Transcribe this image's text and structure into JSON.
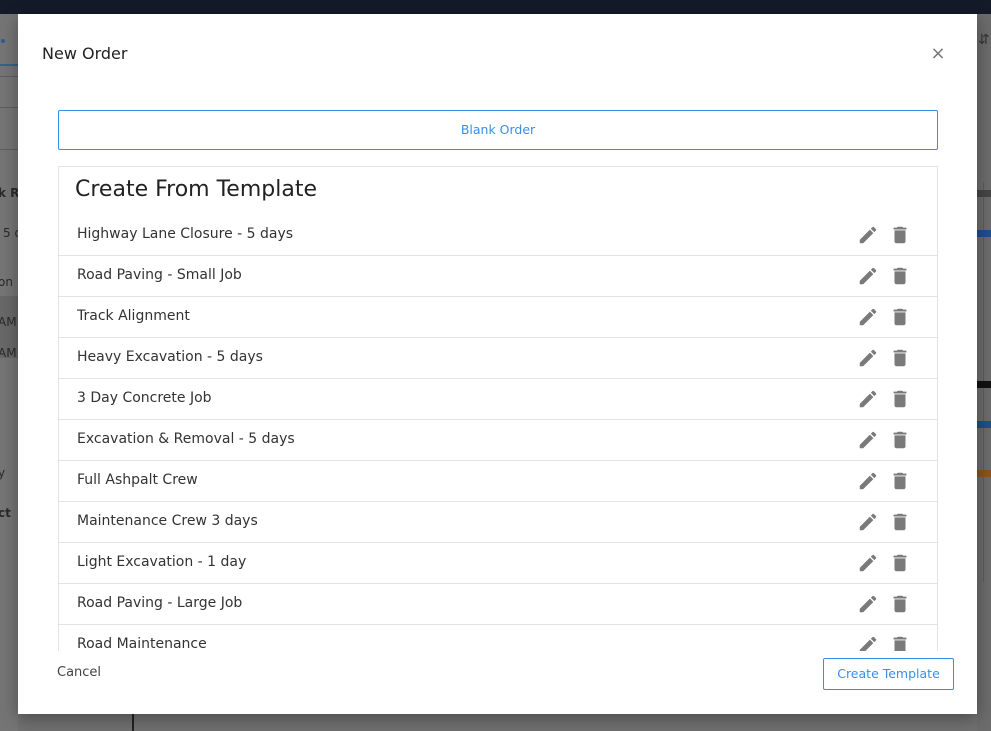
{
  "background": {
    "left_cells": [
      {
        "text": "k R",
        "bold": true
      },
      {
        "text": "5 d",
        "bold": false
      },
      {
        "text": "on",
        "bold": false
      },
      {
        "text": "AM",
        "bold": false
      },
      {
        "text": "AM",
        "bold": false
      },
      {
        "text": "y",
        "bold": false
      },
      {
        "text": "ct",
        "bold": true
      }
    ],
    "bar_colors": [
      "#454545",
      "#1f4f8c",
      "#111111",
      "#1f4f8c",
      "#8a5420"
    ]
  },
  "modal": {
    "title": "New Order",
    "close_label": "×",
    "blank_order_label": "Blank Order",
    "template_section": {
      "heading": "Create From Template",
      "templates": [
        {
          "name": "Highway Lane Closure - 5 days"
        },
        {
          "name": "Road Paving - Small Job"
        },
        {
          "name": "Track Alignment"
        },
        {
          "name": "Heavy Excavation - 5 days"
        },
        {
          "name": "3 Day Concrete Job"
        },
        {
          "name": "Excavation & Removal - 5 days"
        },
        {
          "name": "Full Ashpalt Crew"
        },
        {
          "name": "Maintenance Crew 3 days"
        },
        {
          "name": "Light Excavation - 1 day"
        },
        {
          "name": "Road Paving - Large Job"
        },
        {
          "name": "Road Maintenance"
        }
      ],
      "row_icons": [
        "pencil-icon",
        "trash-icon"
      ]
    },
    "footer": {
      "cancel_label": "Cancel",
      "create_template_label": "Create Template"
    },
    "colors": {
      "accent": "#3a8ee6",
      "icon": "#7a7a7a"
    }
  }
}
